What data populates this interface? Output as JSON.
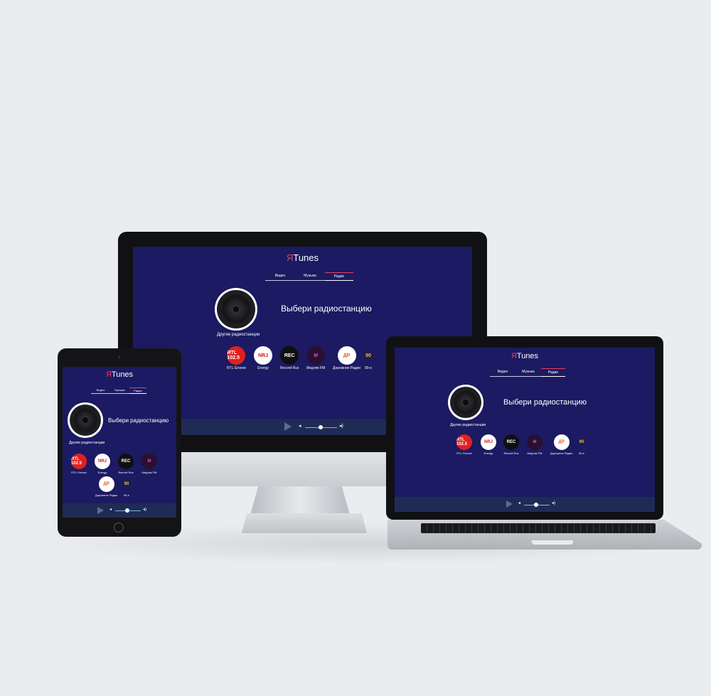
{
  "app": {
    "logo_ya": "Я",
    "logo_rest": "Tunes"
  },
  "tabs": [
    "Видео",
    "Музыка",
    "Радио"
  ],
  "heading": "Выбери радиостанцию",
  "other_stations": "Другие радиостанции",
  "stations": [
    {
      "name": "RTL Groove",
      "mark": "RTL 102.5",
      "icon": "rtl-logo-icon"
    },
    {
      "name": "Energy",
      "mark": "NRJ",
      "icon": "energy-logo-icon"
    },
    {
      "name": "Record Rus",
      "mark": "REC",
      "icon": "record-logo-icon"
    },
    {
      "name": "Медляк FM",
      "mark": "M",
      "icon": "medlyak-logo-icon"
    },
    {
      "name": "Дорожное Радио",
      "mark": "ДР",
      "icon": "dorozhnoe-logo-icon"
    },
    {
      "name": "90-е",
      "mark": "90",
      "icon": "radio90-logo-icon"
    }
  ],
  "player": {
    "volume": 0.45,
    "volume_icon_low": "◂",
    "volume_icon_high": "◂)"
  }
}
